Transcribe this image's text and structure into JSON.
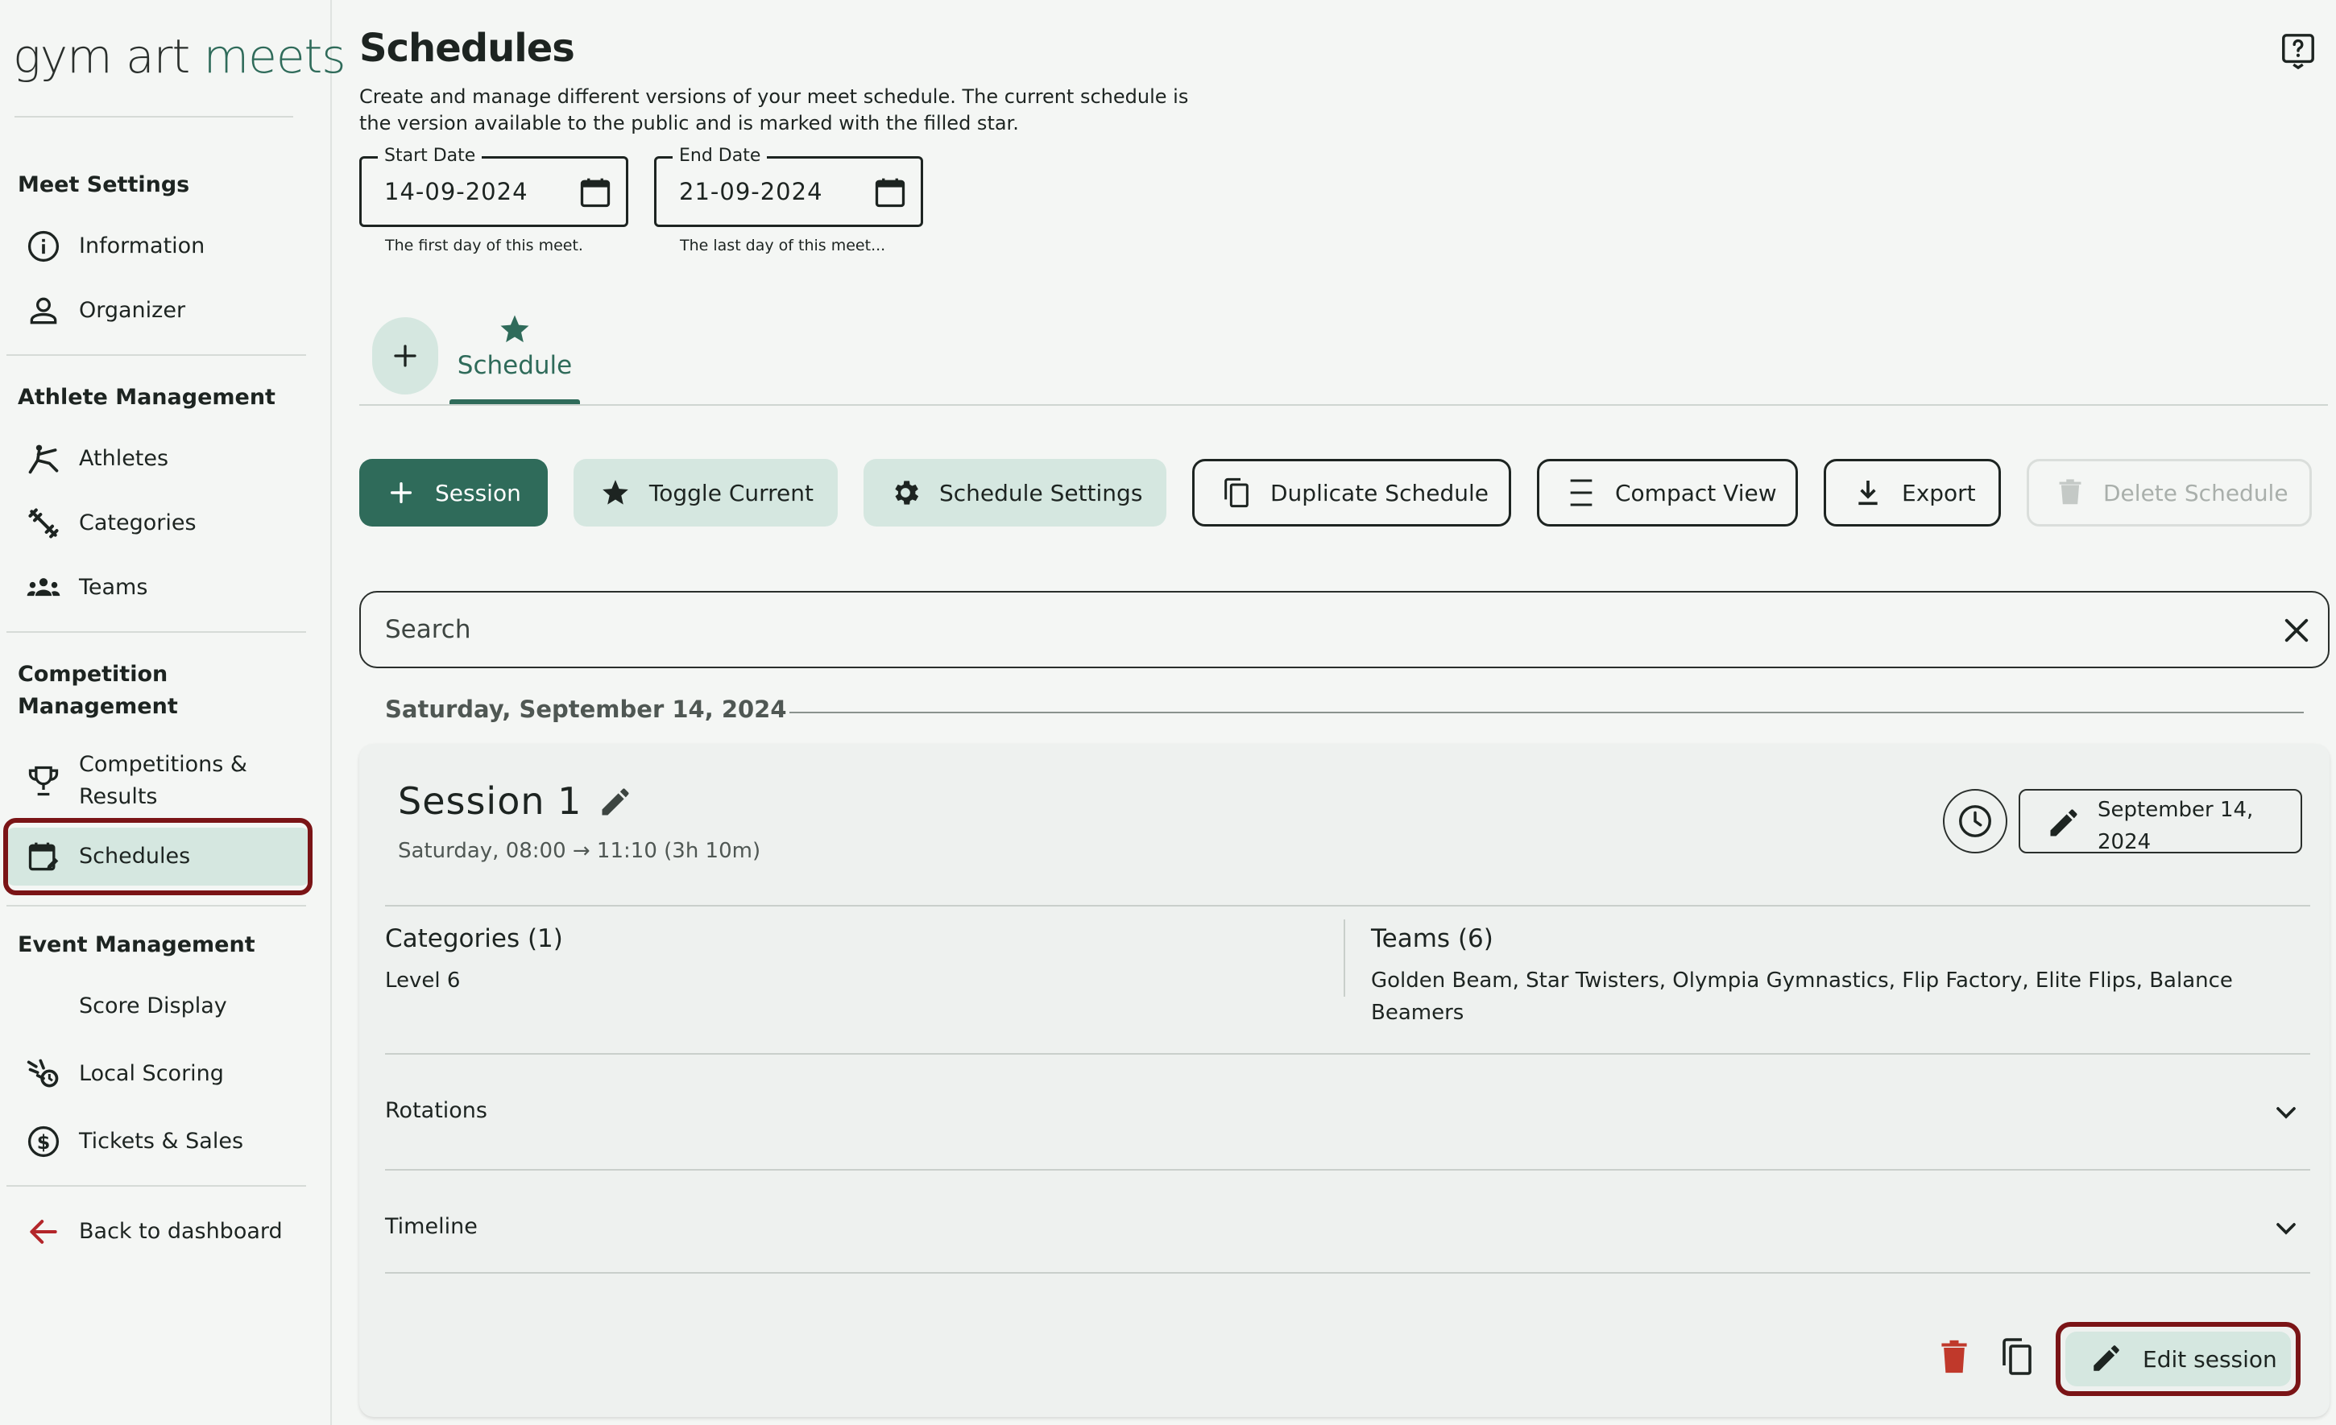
{
  "logo": {
    "part1": "gym art ",
    "part2": "meets"
  },
  "sidebar": {
    "meet_settings": {
      "heading": "Meet Settings",
      "items": [
        {
          "label": "Information",
          "icon": "info-icon"
        },
        {
          "label": "Organizer",
          "icon": "person-icon"
        }
      ]
    },
    "athlete_management": {
      "heading": "Athlete Management",
      "items": [
        {
          "label": "Athletes",
          "icon": "gymnast-icon"
        },
        {
          "label": "Categories",
          "icon": "fitness-icon"
        },
        {
          "label": "Teams",
          "icon": "groups-icon"
        }
      ]
    },
    "competition_management": {
      "heading_line1": "Competition",
      "heading_line2": "Management",
      "items": [
        {
          "label_line1": "Competitions &",
          "label_line2": "Results",
          "icon": "trophy-icon"
        },
        {
          "label": "Schedules",
          "icon": "calendar-edit-icon",
          "active": true
        }
      ]
    },
    "event_management": {
      "heading": "Event Management",
      "items": [
        {
          "label": "Score Display",
          "icon": ""
        },
        {
          "label": "Local Scoring",
          "icon": "scoring-icon"
        },
        {
          "label": "Tickets & Sales",
          "icon": "dollar-icon"
        }
      ]
    },
    "back": {
      "label": "Back to dashboard",
      "icon": "arrow-back-icon"
    }
  },
  "page": {
    "title": "Schedules",
    "description": "Create and manage different versions of your meet schedule. The current schedule is the version available to the public and is marked with the filled star.",
    "help_icon": "help-icon"
  },
  "dates": {
    "start": {
      "label": "Start Date",
      "value": "14-09-2024",
      "hint": "The first day of this meet."
    },
    "end": {
      "label": "End Date",
      "value": "21-09-2024",
      "hint": "The last day of this meet..."
    }
  },
  "tabs": {
    "add_icon": "plus-icon",
    "items": [
      {
        "label": "Schedule",
        "icon": "star-icon",
        "current": true
      }
    ]
  },
  "toolbar": {
    "session": "Session",
    "toggle_current": "Toggle Current",
    "schedule_settings": "Schedule Settings",
    "duplicate_schedule": "Duplicate Schedule",
    "compact_view": "Compact View",
    "export": "Export",
    "delete_schedule": "Delete Schedule"
  },
  "search": {
    "placeholder": "Search"
  },
  "day": {
    "heading": "Saturday, September 14, 2024"
  },
  "session": {
    "title": "Session 1",
    "time": "Saturday, 08:00 → 11:10 (3h 10m)",
    "date_line1": "September 14,",
    "date_line2": "2024",
    "categories": {
      "heading": "Categories (1)",
      "body": "Level 6"
    },
    "teams": {
      "heading": "Teams (6)",
      "body_line1": "Golden Beam, Star Twisters, Olympia Gymnastics, Flip Factory, Elite Flips, Balance",
      "body_line2": "Beamers"
    },
    "rotations": "Rotations",
    "timeline": "Timeline",
    "edit_button": "Edit session"
  },
  "colors": {
    "primary": "#2f6b5a",
    "tonal": "#d5e7e0",
    "highlight_ring": "#7a1416",
    "delete": "#c0392b",
    "background": "#f4f6f4"
  }
}
